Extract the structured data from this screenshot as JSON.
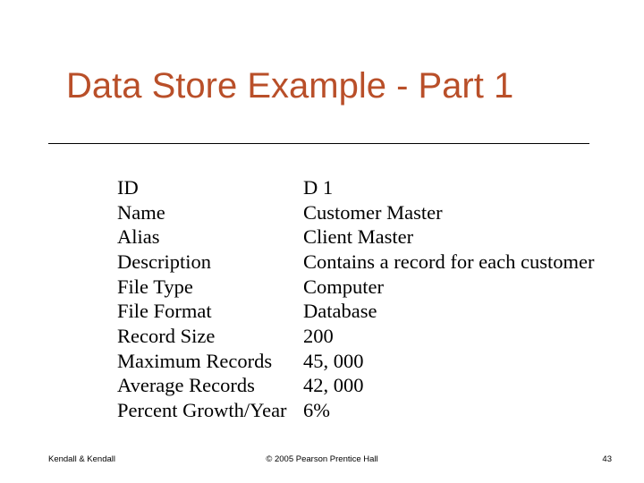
{
  "title": "Data Store Example - Part 1",
  "rows": [
    {
      "label": "ID",
      "value": "D 1"
    },
    {
      "label": "Name",
      "value": "Customer Master"
    },
    {
      "label": "Alias",
      "value": "Client Master"
    },
    {
      "label": "Description",
      "value": "Contains a record for each customer"
    },
    {
      "label": "File Type",
      "value": "Computer"
    },
    {
      "label": "File Format",
      "value": "Database"
    },
    {
      "label": "Record Size",
      "value": "200"
    },
    {
      "label": "Maximum Records",
      "value": "45, 000"
    },
    {
      "label": "Average Records",
      "value": "42, 000"
    },
    {
      "label": "Percent Growth/Year",
      "value": "6%"
    }
  ],
  "footer": {
    "left": "Kendall & Kendall",
    "center": "© 2005 Pearson Prentice Hall",
    "right": "43"
  }
}
